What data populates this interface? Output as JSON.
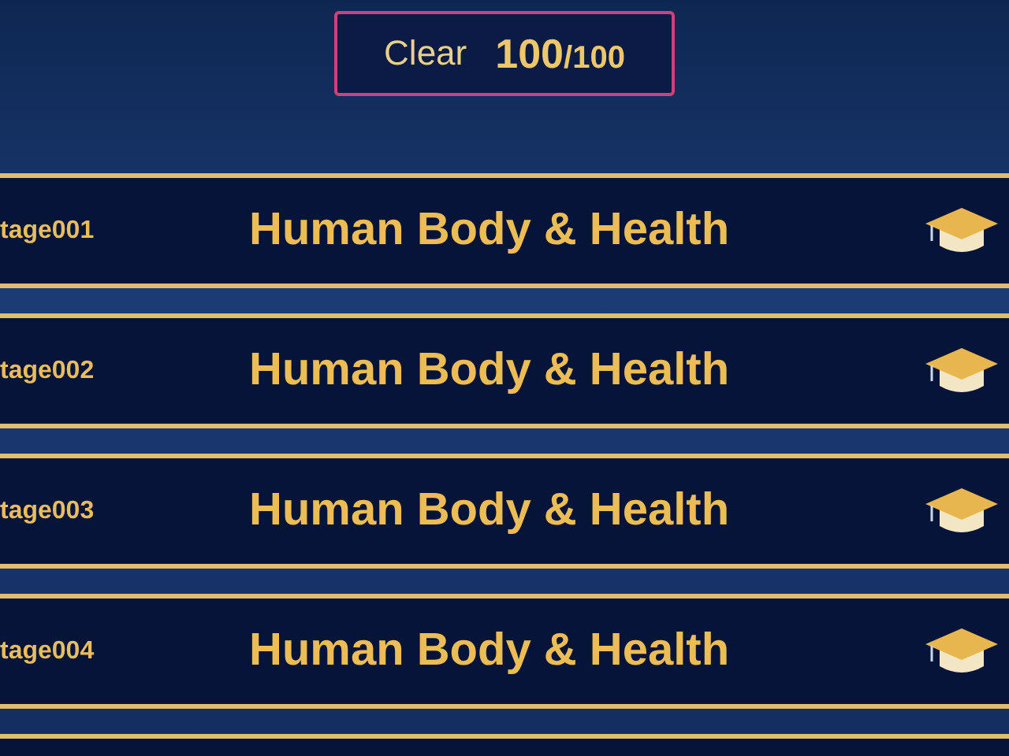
{
  "header": {
    "label": "Clear",
    "score": "100",
    "total": "/100"
  },
  "stages": [
    {
      "stage": "tage001",
      "title": "Human Body & Health"
    },
    {
      "stage": "tage002",
      "title": "Human Body & Health"
    },
    {
      "stage": "tage003",
      "title": "Human Body & Health"
    },
    {
      "stage": "tage004",
      "title": "Human Body & Health"
    }
  ]
}
